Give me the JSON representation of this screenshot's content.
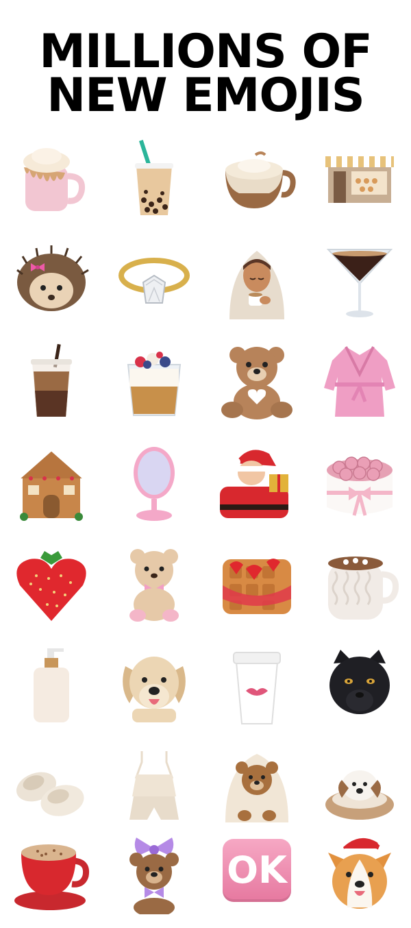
{
  "headline": {
    "line1": "MILLIONS OF",
    "line2": "NEW EMOJIS"
  },
  "emojis": [
    {
      "name": "pink-latte-mug-icon"
    },
    {
      "name": "bubble-tea-icon"
    },
    {
      "name": "cappuccino-knit-cup-icon"
    },
    {
      "name": "bakery-storefront-icon"
    },
    {
      "name": "hedgehog-bow-icon"
    },
    {
      "name": "diamond-ring-icon"
    },
    {
      "name": "hooded-person-tea-icon"
    },
    {
      "name": "espresso-martini-icon"
    },
    {
      "name": "iced-coffee-icon"
    },
    {
      "name": "yogurt-parfait-icon"
    },
    {
      "name": "teddy-bear-heart-icon"
    },
    {
      "name": "pink-robe-icon"
    },
    {
      "name": "gingerbread-house-icon"
    },
    {
      "name": "vanity-mirror-icon"
    },
    {
      "name": "santa-claus-icon"
    },
    {
      "name": "rose-box-icon"
    },
    {
      "name": "heart-strawberry-icon"
    },
    {
      "name": "pink-teddy-bear-icon"
    },
    {
      "name": "strawberry-waffle-icon"
    },
    {
      "name": "hot-chocolate-knit-mug-icon"
    },
    {
      "name": "lotion-bottle-icon"
    },
    {
      "name": "golden-retriever-icon"
    },
    {
      "name": "coffee-cup-lips-icon"
    },
    {
      "name": "black-panther-icon"
    },
    {
      "name": "fluffy-slippers-icon"
    },
    {
      "name": "silk-pajamas-icon"
    },
    {
      "name": "bear-in-blanket-icon"
    },
    {
      "name": "dog-in-bed-icon"
    },
    {
      "name": "red-cappuccino-cup-icon"
    },
    {
      "name": "bear-purple-bow-icon"
    },
    {
      "name": "ok-button-icon",
      "label": "OK"
    },
    {
      "name": "corgi-santa-hat-icon"
    }
  ]
}
